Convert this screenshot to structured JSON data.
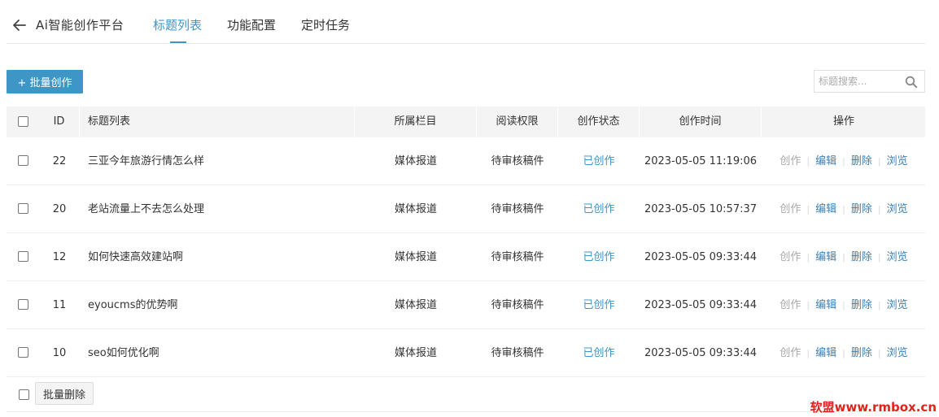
{
  "header": {
    "back_icon": "arrow-left-icon",
    "app_title": "Ai智能创作平台",
    "tabs": [
      {
        "label": "标题列表",
        "active": true
      },
      {
        "label": "功能配置",
        "active": false
      },
      {
        "label": "定时任务",
        "active": false
      }
    ]
  },
  "toolbar": {
    "batch_create_label": "+ 批量创作",
    "search_placeholder": "标题搜索...",
    "search_value": "",
    "search_icon": "search-icon"
  },
  "table": {
    "headers": {
      "id": "ID",
      "title": "标题列表",
      "column": "所属栏目",
      "permission": "阅读权限",
      "status": "创作状态",
      "time": "创作时间",
      "ops": "操作"
    },
    "rows": [
      {
        "id": "22",
        "title": "三亚今年旅游行情怎么样",
        "column": "媒体报道",
        "permission": "待审核稿件",
        "status": "已创作",
        "time": "2023-05-05 11:19:06"
      },
      {
        "id": "20",
        "title": "老站流量上不去怎么处理",
        "column": "媒体报道",
        "permission": "待审核稿件",
        "status": "已创作",
        "time": "2023-05-05 10:57:37"
      },
      {
        "id": "12",
        "title": "如何快速高效建站啊",
        "column": "媒体报道",
        "permission": "待审核稿件",
        "status": "已创作",
        "time": "2023-05-05 09:33:44"
      },
      {
        "id": "11",
        "title": "eyoucms的优势啊",
        "column": "媒体报道",
        "permission": "待审核稿件",
        "status": "已创作",
        "time": "2023-05-05 09:33:44"
      },
      {
        "id": "10",
        "title": "seo如何优化啊",
        "column": "媒体报道",
        "permission": "待审核稿件",
        "status": "已创作",
        "time": "2023-05-05 09:33:44"
      }
    ],
    "ops": {
      "create": "创作",
      "edit": "编辑",
      "delete": "删除",
      "view": "浏览",
      "separator": "|"
    }
  },
  "footer": {
    "batch_delete_label": "批量删除"
  },
  "watermark": "软盟www.rmbox.cn",
  "colors": {
    "accent": "#3d96c6",
    "link": "#3d7fb5",
    "disabled": "#a8a8a8",
    "watermark": "#e0231c"
  }
}
